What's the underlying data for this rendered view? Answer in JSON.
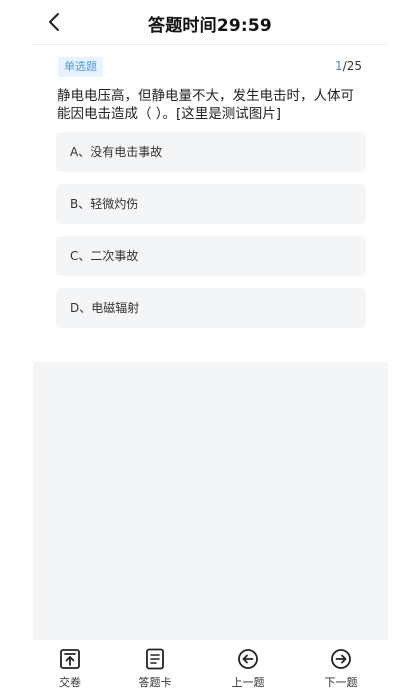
{
  "header": {
    "title": "答题时间29:59",
    "back_icon": "chevron-left-icon"
  },
  "question": {
    "type_badge": "单选题",
    "progress_current": "1",
    "progress_total": "/25",
    "text": "静电电压高，但静电量不大，发生电击时，人体可能因电击造成（ ）。[这里是测试图片]",
    "options": [
      {
        "label": "A、没有电击事故"
      },
      {
        "label": "B、轻微灼伤"
      },
      {
        "label": "C、二次事故"
      },
      {
        "label": "D、电磁辐射"
      }
    ]
  },
  "bottom_nav": [
    {
      "label": "交卷",
      "icon": "submit-icon"
    },
    {
      "label": "答题卡",
      "icon": "answer-card-icon"
    },
    {
      "label": "上一题",
      "icon": "previous-icon"
    },
    {
      "label": "下一题",
      "icon": "next-icon"
    }
  ],
  "colors": {
    "accent": "#3b8fe8",
    "badge_bg": "#e8f3ff",
    "option_bg": "#f4f5f7",
    "image_placeholder_bg": "#f3f5f7"
  }
}
